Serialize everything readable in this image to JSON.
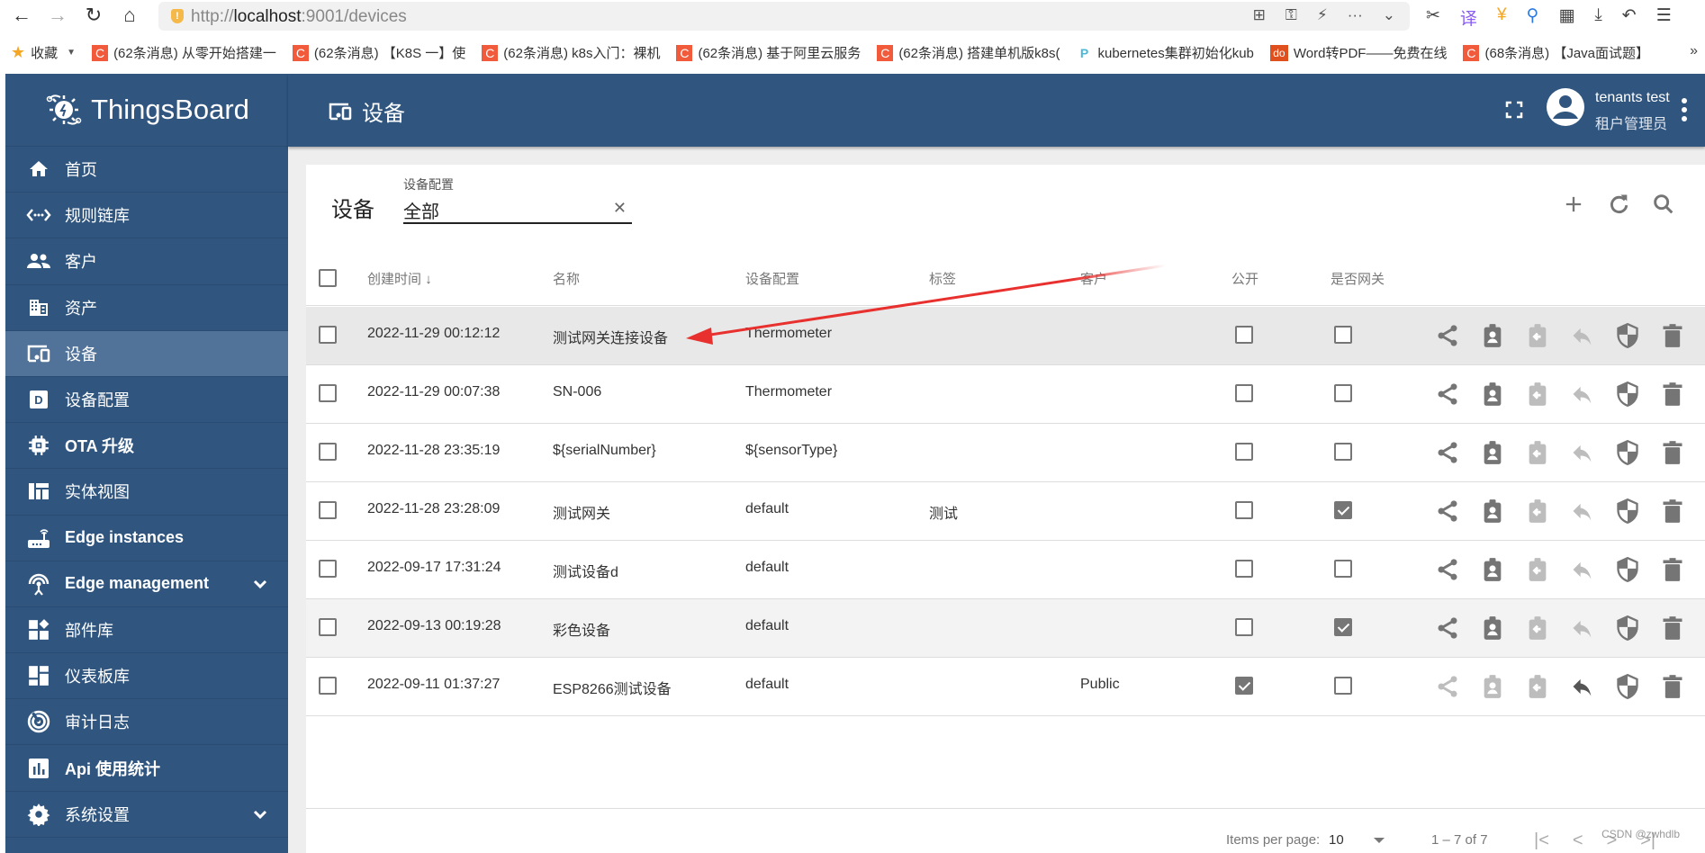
{
  "browser": {
    "url_prefix": "http://",
    "url_host": "localhost",
    "url_rest": ":9001/devices",
    "bookmarks": [
      {
        "label": "收藏",
        "icon": "star-icon"
      },
      {
        "label": "(62条消息) 从零开始搭建一",
        "icon": "csdn-icon"
      },
      {
        "label": "(62条消息) 【K8S 一】使",
        "icon": "csdn-icon"
      },
      {
        "label": "(62条消息) k8s入门：裸机",
        "icon": "csdn-icon"
      },
      {
        "label": "(62条消息) 基于阿里云服务",
        "icon": "csdn-icon"
      },
      {
        "label": "(62条消息) 搭建单机版k8s(",
        "icon": "csdn-icon"
      },
      {
        "label": "kubernetes集群初始化kub",
        "icon": "p-icon"
      },
      {
        "label": "Word转PDF——免费在线",
        "icon": "do-icon"
      },
      {
        "label": "(68条消息) 【Java面试题】",
        "icon": "csdn-icon"
      }
    ],
    "more_label": "»"
  },
  "app": {
    "brand": "ThingsBoard",
    "page_title": "设备",
    "user": {
      "name": "tenants test",
      "role": "租户管理员"
    }
  },
  "sidebar": {
    "items": [
      {
        "label": "首页",
        "icon": "home-icon"
      },
      {
        "label": "规则链库",
        "icon": "rule-chain-icon"
      },
      {
        "label": "客户",
        "icon": "customers-icon"
      },
      {
        "label": "资产",
        "icon": "assets-icon"
      },
      {
        "label": "设备",
        "icon": "devices-icon",
        "active": true
      },
      {
        "label": "设备配置",
        "icon": "device-profile-icon"
      },
      {
        "label": "OTA 升级",
        "icon": "chip-icon"
      },
      {
        "label": "实体视图",
        "icon": "entity-view-icon"
      },
      {
        "label": "Edge instances",
        "icon": "router-icon"
      },
      {
        "label": "Edge management",
        "icon": "antenna-icon",
        "expandable": true
      },
      {
        "label": "部件库",
        "icon": "widgets-icon"
      },
      {
        "label": "仪表板库",
        "icon": "dashboard-icon"
      },
      {
        "label": "审计日志",
        "icon": "audit-icon"
      },
      {
        "label": "Api 使用统计",
        "icon": "api-usage-icon"
      },
      {
        "label": "系统设置",
        "icon": "gear-icon",
        "expandable": true
      }
    ]
  },
  "card": {
    "title": "设备",
    "filter": {
      "label": "设备配置",
      "value": "全部"
    },
    "columns": {
      "created": "创建时间",
      "name": "名称",
      "profile": "设备配置",
      "label": "标签",
      "customer": "客户",
      "public": "公开",
      "gateway": "是否网关"
    },
    "rows": [
      {
        "created": "2022-11-29 00:12:12",
        "name": "测试网关连接设备",
        "profile": "Thermometer",
        "label": "",
        "customer": "",
        "public": false,
        "gateway": false
      },
      {
        "created": "2022-11-29 00:07:38",
        "name": "SN-006",
        "profile": "Thermometer",
        "label": "",
        "customer": "",
        "public": false,
        "gateway": false
      },
      {
        "created": "2022-11-28 23:35:19",
        "name": "${serialNumber}",
        "profile": "${sensorType}",
        "label": "",
        "customer": "",
        "public": false,
        "gateway": false
      },
      {
        "created": "2022-11-28 23:28:09",
        "name": "测试网关",
        "profile": "default",
        "label": "测试",
        "customer": "",
        "public": false,
        "gateway": true
      },
      {
        "created": "2022-09-17 17:31:24",
        "name": "测试设备d",
        "profile": "default",
        "label": "",
        "customer": "",
        "public": false,
        "gateway": false
      },
      {
        "created": "2022-09-13 00:19:28",
        "name": "彩色设备",
        "profile": "default",
        "label": "",
        "customer": "",
        "public": false,
        "gateway": true
      },
      {
        "created": "2022-09-11 01:37:27",
        "name": "ESP8266测试设备",
        "profile": "default",
        "label": "",
        "customer": "Public",
        "public": true,
        "gateway": false
      }
    ],
    "paginator": {
      "items_per_page_label": "Items per page:",
      "page_size": "10",
      "range": "1 – 7 of 7"
    }
  },
  "watermark": "CSDN @zwhdlb",
  "colors": {
    "primary": "#305680",
    "active_item": "#527399",
    "annotation_arrow": "#e8312f"
  }
}
